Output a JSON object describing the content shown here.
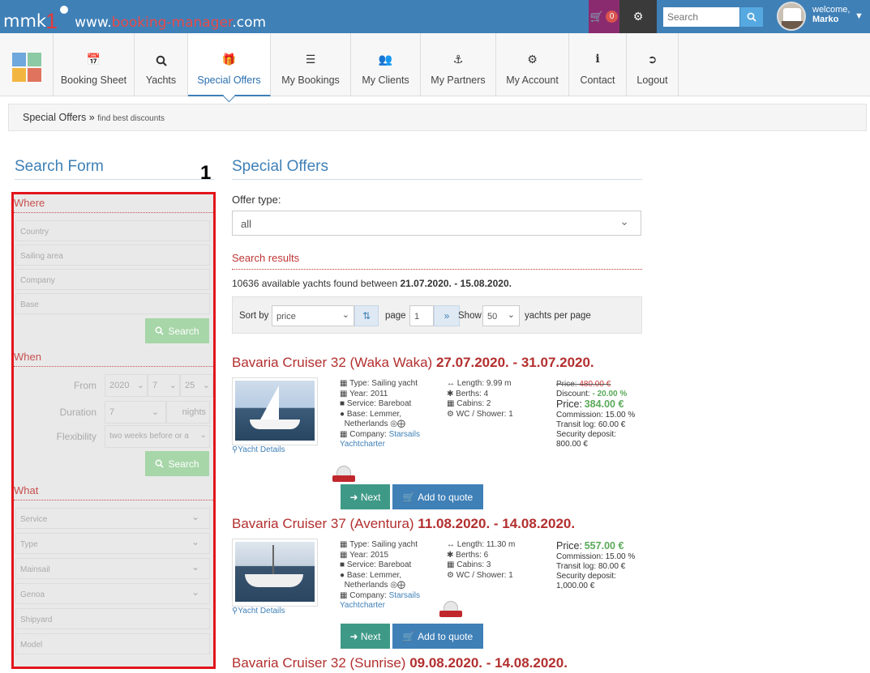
{
  "topbar": {
    "logo_mmk": "mmk",
    "logo_one": "1",
    "logo_url_pre": "www.",
    "logo_url_hl": "booking-manager",
    "logo_url_post": ".com",
    "cart_count": "0",
    "search_placeholder": "Search",
    "welcome": "welcome,",
    "user": "Marko",
    "accent": "#3f80b7",
    "cart_color": "#8b2b6f"
  },
  "nav": {
    "items": [
      {
        "label": "Booking Sheet",
        "icon": "calendar-icon"
      },
      {
        "label": "Yachts",
        "icon": "search-icon"
      },
      {
        "label": "Special Offers",
        "icon": "gift-icon"
      },
      {
        "label": "My Bookings",
        "icon": "list-icon"
      },
      {
        "label": "My Clients",
        "icon": "users-icon"
      },
      {
        "label": "My Partners",
        "icon": "anchor-icon"
      },
      {
        "label": "My Account",
        "icon": "cogs-icon"
      },
      {
        "label": "Contact",
        "icon": "info-icon"
      },
      {
        "label": "Logout",
        "icon": "sign-out-icon"
      }
    ]
  },
  "breadcrumb": {
    "main": "Special Offers",
    "sep": "»",
    "sub": "find best discounts"
  },
  "search_form": {
    "title": "Search Form",
    "marker": "1",
    "where": "Where",
    "country": "Country",
    "sailing_area": "Sailing area",
    "company": "Company",
    "base": "Base",
    "search_label": "Search",
    "when": "When",
    "from_label": "From",
    "from_year": "2020",
    "from_month": "7",
    "from_day": "25",
    "duration_label": "Duration",
    "duration_value": "7",
    "nights": "nights",
    "flexibility_label": "Flexibility",
    "flexibility_value": "two weeks before or a",
    "what": "What",
    "service": "Service",
    "type": "Type",
    "mainsail": "Mainsail",
    "genoa": "Genoa",
    "shipyard": "Shipyard",
    "model": "Model"
  },
  "offers": {
    "title": "Special Offers",
    "offer_type_label": "Offer type:",
    "offer_type_value": "all",
    "search_results": "Search results",
    "found_pre": "10636 available yachts found between",
    "found_dates": "21.07.2020. - 15.08.2020.",
    "sort_by": "Sort by",
    "sort_value": "price",
    "page_label": "page",
    "page_value": "1",
    "show_label": "Show",
    "show_value": "50",
    "per_page": "yachts per page"
  },
  "yachts": [
    {
      "name": "Bavaria Cruiser 32 (Waka Waka)",
      "dates": "27.07.2020. - 31.07.2020.",
      "type": "Type: Sailing yacht",
      "year": "Year: 2011",
      "service": "Service: Bareboat",
      "base1": "Base: Lemmer,",
      "base2": "Netherlands",
      "company_label": "Company:",
      "company1": "Starsails",
      "company2": "Yachtcharter",
      "length": "Length: 9.99 m",
      "berths": "Berths: 4",
      "cabins": "Cabins: 2",
      "wc": "WC / Shower: 1",
      "old_price_label": "Price:",
      "old_price": "480.00 €",
      "discount_label": "Discount:",
      "discount": "- 20.00 %",
      "price_label": "Price:",
      "price": "384.00 €",
      "commission": "Commission: 15.00 %",
      "transit": "Transit log: 60.00 €",
      "deposit_label": "Security deposit:",
      "deposit": "800.00 €",
      "details": "Yacht Details",
      "next": "Next",
      "quote": "Add to quote"
    },
    {
      "name": "Bavaria Cruiser 37 (Aventura)",
      "dates": "11.08.2020. - 14.08.2020.",
      "type": "Type: Sailing yacht",
      "year": "Year: 2015",
      "service": "Service: Bareboat",
      "base1": "Base: Lemmer,",
      "base2": "Netherlands",
      "company_label": "Company:",
      "company1": "Starsails",
      "company2": "Yachtcharter",
      "length": "Length: 11.30 m",
      "berths": "Berths: 6",
      "cabins": "Cabins: 3",
      "wc": "WC / Shower: 1",
      "price_label": "Price:",
      "price": "557.00 €",
      "commission": "Commission: 15.00 %",
      "transit": "Transit log: 80.00 €",
      "deposit_label": "Security deposit:",
      "deposit": "1,000.00 €",
      "details": "Yacht Details",
      "next": "Next",
      "quote": "Add to quote"
    },
    {
      "name": "Bavaria Cruiser 32 (Sunrise)",
      "dates": "09.08.2020. - 14.08.2020."
    }
  ]
}
